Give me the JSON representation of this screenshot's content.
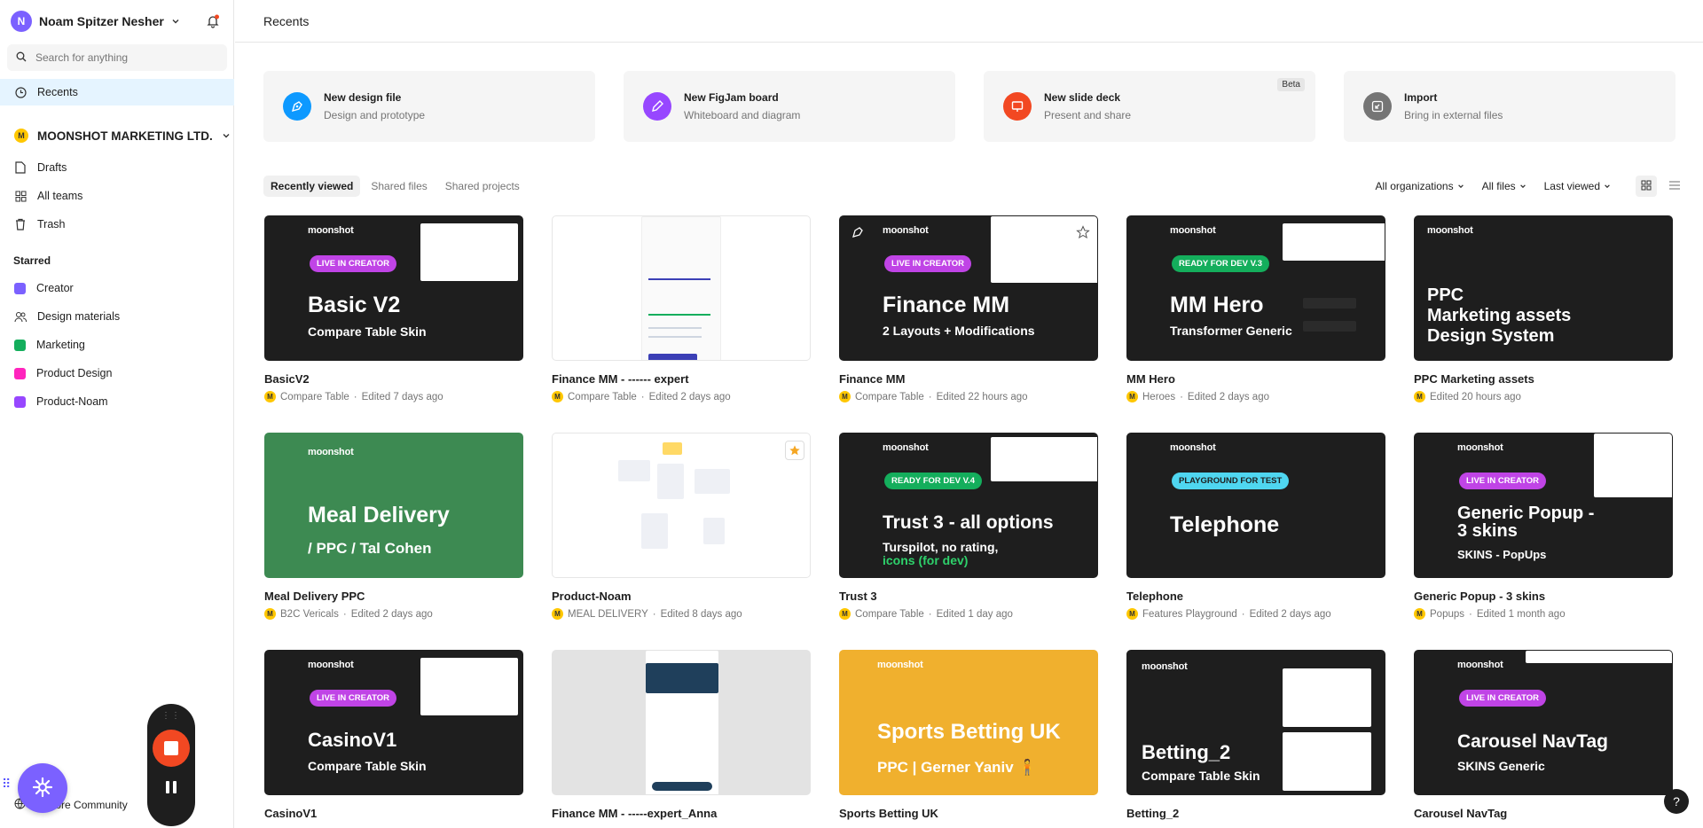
{
  "user": {
    "initial": "N",
    "name": "Noam Spitzer Nesher"
  },
  "search": {
    "placeholder": "Search for anything"
  },
  "nav": {
    "recents": "Recents",
    "drafts": "Drafts",
    "all_teams": "All teams",
    "trash": "Trash",
    "explore_community": "Explore Community"
  },
  "org": {
    "initial": "M",
    "name": "MOONSHOT MARKETING LTD."
  },
  "starred": {
    "heading": "Starred",
    "items": [
      {
        "label": "Creator",
        "color": "#7b61ff"
      },
      {
        "label": "Design materials",
        "color": "icon"
      },
      {
        "label": "Marketing",
        "color": "#14ae5c"
      },
      {
        "label": "Product Design",
        "color": "#ff24bd"
      },
      {
        "label": "Product-Noam",
        "color": "#9747ff"
      }
    ]
  },
  "header": {
    "title": "Recents"
  },
  "create": [
    {
      "title": "New design file",
      "subtitle": "Design and prototype",
      "color": "#0d99ff"
    },
    {
      "title": "New FigJam board",
      "subtitle": "Whiteboard and diagram",
      "color": "#9747ff"
    },
    {
      "title": "New slide deck",
      "subtitle": "Present and share",
      "color": "#f24822",
      "badge": "Beta"
    },
    {
      "title": "Import",
      "subtitle": "Bring in external files",
      "color": "#757575"
    }
  ],
  "tabs": [
    "Recently viewed",
    "Shared files",
    "Shared projects"
  ],
  "filters": {
    "org": "All organizations",
    "files": "All files",
    "sort": "Last viewed"
  },
  "brand_text": "moonshot",
  "files": [
    {
      "name": "BasicV2",
      "project": "Compare Table",
      "edited": "Edited 7 days ago",
      "thumb_title": "Basic V2",
      "thumb_sub": "Compare Table Skin",
      "badge": "LIVE IN CREATOR"
    },
    {
      "name": "Finance MM - ------ expert",
      "project": "Compare Table",
      "edited": "Edited 2 days ago"
    },
    {
      "name": "Finance MM",
      "project": "Compare Table",
      "edited": "Edited 22 hours ago",
      "thumb_title": "Finance MM",
      "thumb_sub": "2 Layouts + Modifications",
      "badge": "LIVE IN CREATOR"
    },
    {
      "name": "MM Hero",
      "project": "Heroes",
      "edited": "Edited 2 days ago",
      "thumb_title": "MM Hero",
      "thumb_sub": "Transformer Generic",
      "badge": "READY FOR DEV V.3"
    },
    {
      "name": "PPC  Marketing assets",
      "project": "",
      "edited": "Edited 20 hours ago",
      "thumb_title": "PPC\nMarketing assets\nDesign System"
    },
    {
      "name": "Meal Delivery PPC",
      "project": "B2C Vericals",
      "edited": "Edited 2 days ago",
      "thumb_title": "Meal Delivery",
      "thumb_sub": "/ PPC / Tal Cohen"
    },
    {
      "name": "Product-Noam",
      "project": "MEAL DELIVERY",
      "edited": "Edited 8 days ago"
    },
    {
      "name": "Trust 3",
      "project": "Compare Table",
      "edited": "Edited 1 day ago",
      "thumb_title": "Trust 3 - all options",
      "thumb_sub": "Turspilot, no rating,",
      "thumb_sub2": "icons (for dev)",
      "badge": "READY FOR DEV V.4"
    },
    {
      "name": "Telephone",
      "project": "Features Playground",
      "edited": "Edited 2 days ago",
      "thumb_title": "Telephone",
      "badge": "PLAYGROUND FOR TEST"
    },
    {
      "name": "Generic Popup - 3 skins",
      "project": "Popups",
      "edited": "Edited 1 month ago",
      "thumb_title": "Generic Popup - 3 skins",
      "thumb_sub": "SKINS - PopUps",
      "badge": "LIVE IN CREATOR"
    },
    {
      "name": "CasinoV1",
      "project": "",
      "edited": "",
      "thumb_title": "CasinoV1",
      "thumb_sub": "Compare Table Skin",
      "badge": "LIVE IN CREATOR"
    },
    {
      "name": "Finance MM - -----expert_Anna",
      "project": "",
      "edited": ""
    },
    {
      "name": "Sports Betting UK",
      "project": "",
      "edited": "",
      "thumb_title": "Sports Betting UK",
      "thumb_sub": "PPC | Gerner Yaniv 🧍"
    },
    {
      "name": "Betting_2",
      "project": "",
      "edited": "",
      "thumb_title": "Betting_2",
      "thumb_sub": "Compare Table Skin"
    },
    {
      "name": "Carousel NavTag",
      "project": "",
      "edited": "",
      "thumb_title": "Carousel NavTag",
      "thumb_sub": "SKINS Generic",
      "badge": "LIVE IN CREATOR"
    }
  ],
  "help": "?"
}
